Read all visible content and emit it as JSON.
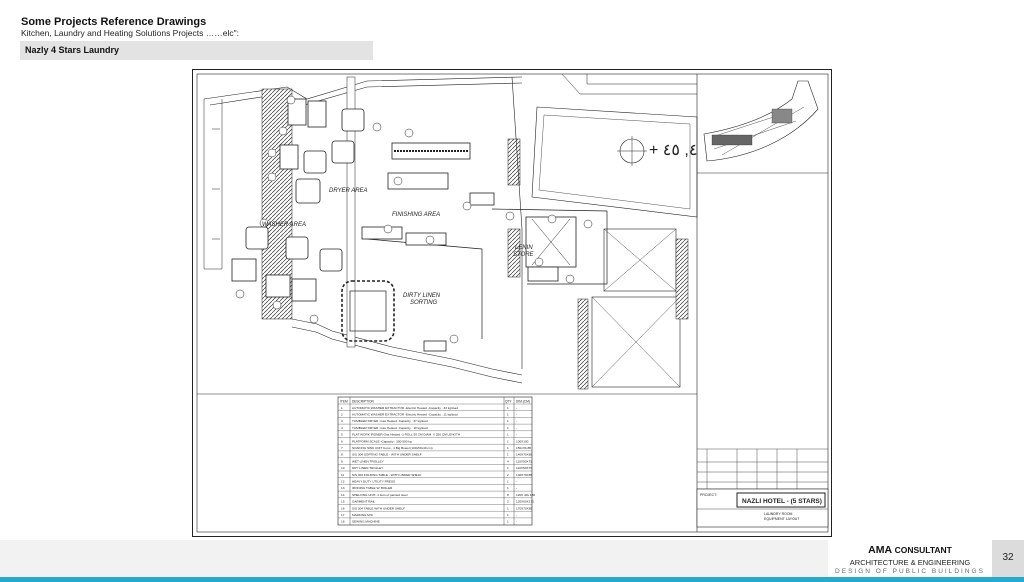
{
  "header": {
    "title": "Some Projects Reference Drawings",
    "subtitle": "Kitchen, Laundry and Heating Solutions Projects ……elc\":"
  },
  "project_label": "Nazly 4 Stars Laundry",
  "drawing": {
    "areas": {
      "dryer": "DRYER AREA",
      "washer": "WASHER AREA",
      "finishing": "FINISHING AREA",
      "lenin": "LENIN",
      "store": "STORE",
      "dirty_line1": "DIRTY LINEN",
      "dirty_line2": "SORTING"
    },
    "table_headers": {
      "item": "ITEM",
      "desc": "DESCRIPTION",
      "qty": "QTY",
      "dim": "DIM.(CM)"
    },
    "schedule": [
      {
        "no": "1",
        "desc": "AUTOMATIC WASHER EXTRACTOR -Electric Heated -Capacity : 33 kg/load",
        "qty": "1",
        "dim": "-"
      },
      {
        "no": "2",
        "desc": "AUTOMATIC WASHER EXTRACTOR -Electric Heated -Capacity : 11 kg/load",
        "qty": "1",
        "dim": "-"
      },
      {
        "no": "3",
        "desc": "TUMBLER DRYER -Gas Heated -Capacity : 37 kg/load",
        "qty": "1",
        "dim": "-"
      },
      {
        "no": "4",
        "desc": "TUMBLER DRYER -Gas Heated -Capacity : 10 kg/load",
        "qty": "1",
        "dim": "-"
      },
      {
        "no": "5",
        "desc": "FLAT WORK IRONER-Gas Heated -1 ROLL 50 CM DIAM. X 250 CM LENGTH",
        "qty": "1",
        "dim": "-"
      },
      {
        "no": "6",
        "desc": "PLATFORM SCALE -Capacity : 300-500 kg",
        "qty": "1",
        "dim": "100X100"
      },
      {
        "no": "7",
        "desc": "SOAKING SINK UNIT Cono - 1 Big Bowel (100x50x40 cm)",
        "qty": "1",
        "dim": "150x70x85"
      },
      {
        "no": "8",
        "desc": "S/S 304 SORTING TABLE - WITH UNDER SHELF",
        "qty": "1",
        "dim": "140X70X85"
      },
      {
        "no": "9",
        "desc": "WET LINEN TROLLEY",
        "qty": "4",
        "dim": "110X90X75"
      },
      {
        "no": "10",
        "desc": "DRY LINEN TROLLEY",
        "qty": "1",
        "dim": "110X50X75"
      },
      {
        "no": "11",
        "desc": "S/S 304 FOLDING TABLE - WITH UNDER SHELF",
        "qty": "2",
        "dim": "130X70X85"
      },
      {
        "no": "12",
        "desc": "HEAVY DUTY UTILITY PRESS",
        "qty": "1",
        "dim": "-"
      },
      {
        "no": "13",
        "desc": "IRONING TABLE W. BOILER",
        "qty": "1",
        "dim": "-"
      },
      {
        "no": "14",
        "desc": "SHELVING UNIT- 4 tiers of painted steel",
        "qty": "8",
        "dim": "120X 40x 180"
      },
      {
        "no": "15",
        "desc": "GARMENT RAIL",
        "qty": "2",
        "dim": "120X60X170"
      },
      {
        "no": "16",
        "desc": "S/S 304 TABLE WITH UNDER SHELF",
        "qty": "1",
        "dim": "170X70X85"
      },
      {
        "no": "17",
        "desc": "MARKING M/C",
        "qty": "1",
        "dim": "-"
      },
      {
        "no": "18",
        "desc": "SEWING MACHINE",
        "qty": "1",
        "dim": "-"
      }
    ],
    "title_block": {
      "project": "PROJECT:",
      "title": "NAZLI HOTEL - (5 STARS)",
      "sheet_title1": "LAUNDRY ROOM",
      "sheet_title2": "EQUIPMENT LAYOUT"
    }
  },
  "footer": {
    "brand": "AMA",
    "brand_word": "CONSULTANT",
    "line1": "ARCHITECTURE & ENGINEERING",
    "line2": "DESIGN OF PUBLIC BUILDINGS",
    "page": "32"
  }
}
